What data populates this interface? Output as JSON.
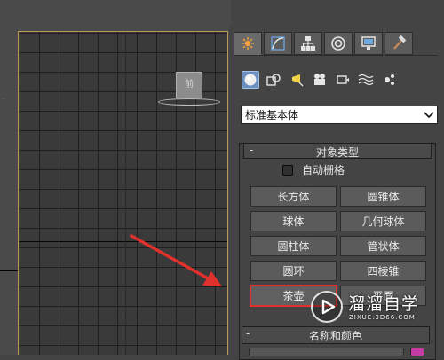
{
  "viewport": {
    "viewcube_face": "前",
    "dot_mark": "."
  },
  "command_panel": {
    "tabs": [
      {
        "name": "create",
        "icon": "sun-burst-icon",
        "active": true
      },
      {
        "name": "modify",
        "icon": "curve-icon"
      },
      {
        "name": "hierarchy",
        "icon": "hierarchy-icon"
      },
      {
        "name": "motion",
        "icon": "motion-circle-icon"
      },
      {
        "name": "display",
        "icon": "monitor-icon"
      },
      {
        "name": "utilities",
        "icon": "hammer-icon"
      }
    ],
    "categories": [
      {
        "icon": "geometry-sphere-icon",
        "active": true
      },
      {
        "icon": "shapes-icon"
      },
      {
        "icon": "lights-icon"
      },
      {
        "icon": "cameras-icon"
      },
      {
        "icon": "helpers-icon"
      },
      {
        "icon": "space-warps-icon"
      },
      {
        "icon": "systems-icon"
      }
    ],
    "dropdown_value": "标准基本体",
    "object_type": {
      "title": "对象类型",
      "collapse_glyph": "-",
      "autogrid_label": "自动栅格",
      "buttons": [
        "长方体",
        "圆锥体",
        "球体",
        "几何球体",
        "圆柱体",
        "管状体",
        "圆环",
        "四棱锥",
        "茶壶",
        "平面"
      ]
    },
    "name_color": {
      "title": "名称和颜色",
      "collapse_glyph": "-",
      "swatch_color": "#c53ca8"
    }
  },
  "highlight_color": "#e0312c",
  "watermark": {
    "title": "溜溜自学",
    "url": "ZIXUE.3D66.COM"
  }
}
